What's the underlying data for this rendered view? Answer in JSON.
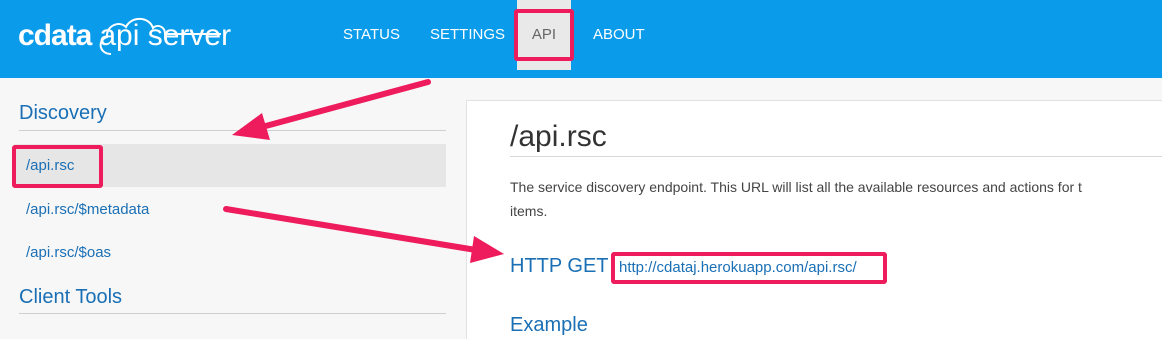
{
  "header": {
    "logo_brand": "cdata",
    "logo_product": "api server",
    "nav": [
      {
        "label": "STATUS"
      },
      {
        "label": "SETTINGS"
      },
      {
        "label": "API"
      },
      {
        "label": "ABOUT"
      }
    ]
  },
  "sidebar": {
    "sections": [
      {
        "heading": "Discovery",
        "items": [
          {
            "label": "/api.rsc"
          },
          {
            "label": "/api.rsc/$metadata"
          },
          {
            "label": "/api.rsc/$oas"
          }
        ]
      },
      {
        "heading": "Client Tools"
      }
    ]
  },
  "main": {
    "title": "/api.rsc",
    "description_line1": "The service discovery endpoint. This URL will list all the available resources and actions for t",
    "description_line2": "items.",
    "http_method_label": "HTTP GET",
    "endpoint_url": "http://cdataj.herokuapp.com/api.rsc/",
    "example_heading": "Example"
  },
  "colors": {
    "header_bg": "#0a9bea",
    "link_blue": "#1a6fb5",
    "highlight": "#ee1c5c"
  }
}
